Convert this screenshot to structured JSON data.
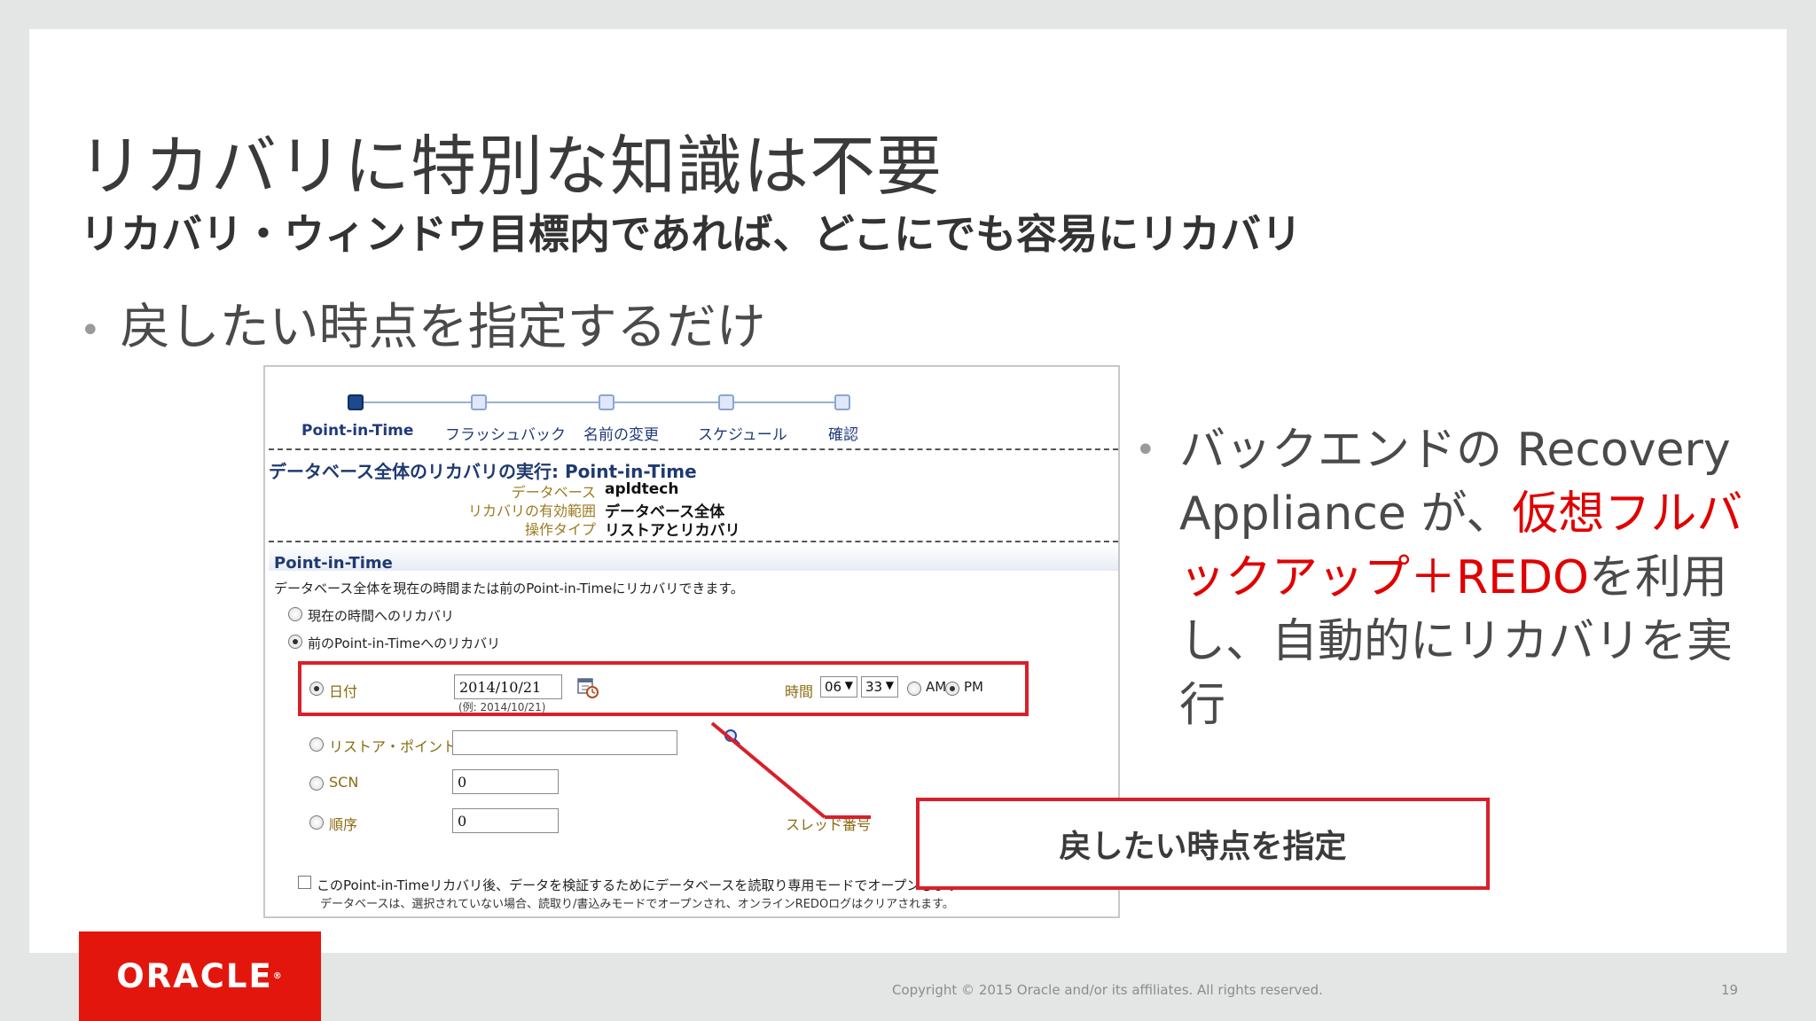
{
  "title": "リカバリに特別な知識は不要",
  "subtitle": "リカバリ・ウィンドウ目標内であれば、どこにでも容易にリカバリ",
  "bullet1": "戻したい時点を指定するだけ",
  "bullet2": {
    "part1": "バックエンドの Recovery Appliance が、",
    "highlight": "仮想フルバックアップ＋REDO",
    "part2": "を利用し、自動的にリカバリを実行"
  },
  "wizard": {
    "steps": [
      "Point-in-Time",
      "フラッシュバック",
      "名前の変更",
      "スケジュール",
      "確認"
    ],
    "section_title": "データベース全体のリカバリの実行: Point-in-Time",
    "info": [
      {
        "label": "データベース",
        "value": "apldtech"
      },
      {
        "label": "リカバリの有効範囲",
        "value": "データベース全体"
      },
      {
        "label": "操作タイプ",
        "value": "リストアとリカバリ"
      }
    ],
    "pit_header": "Point-in-Time",
    "pit_desc": "データベース全体を現在の時間または前のPoint-in-Timeにリカバリできます。",
    "option_current": "現在の時間へのリカバリ",
    "option_previous": "前のPoint-in-Timeへのリカバリ",
    "date_label": "日付",
    "date_value": "2014/10/21",
    "date_example": "(例: 2014/10/21)",
    "time_label": "時間",
    "hour_value": "06",
    "minute_value": "33",
    "am_label": "AM",
    "pm_label": "PM",
    "restore_point_label": "リストア・ポイント",
    "scn_label": "SCN",
    "scn_value": "0",
    "sequence_label": "順序",
    "sequence_value": "0",
    "thread_label": "スレッド番号",
    "checkbox_text": "このPoint-in-Timeリカバリ後、データを検証するためにデータベースを読取り専用モードでオープンします",
    "checkbox_note": "データベースは、選択されていない場合、読取り/書込みモードでオープンされ、オンラインREDOログはクリアされます。"
  },
  "callout": "戻したい時点を指定",
  "logo": "ORACLE",
  "copyright": "Copyright © 2015 Oracle and/or its affiliates. All rights reserved.",
  "page_number": "19"
}
